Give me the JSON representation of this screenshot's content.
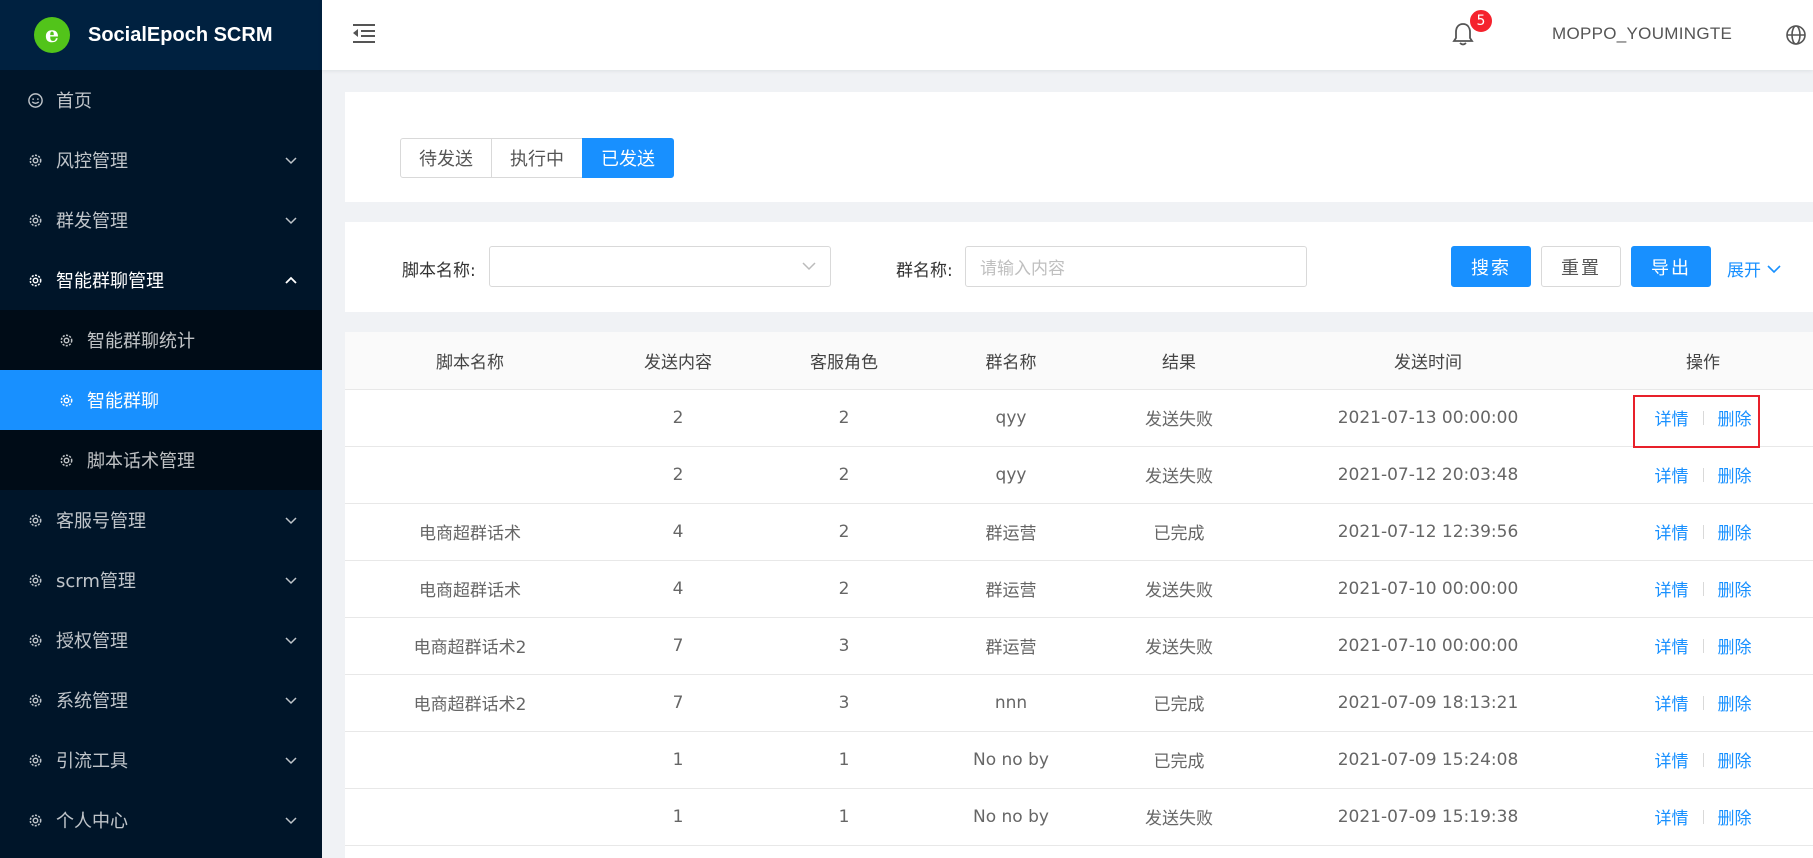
{
  "app": {
    "title": "SocialEpoch SCRM",
    "logo_letter": "e"
  },
  "sidebar": {
    "items": [
      {
        "label": "首页",
        "icon": "smile-icon"
      },
      {
        "label": "风控管理",
        "icon": "gear-icon"
      },
      {
        "label": "群发管理",
        "icon": "gear-icon"
      },
      {
        "label": "智能群聊管理",
        "icon": "gear-icon",
        "open": true,
        "children": [
          {
            "label": "智能群聊统计"
          },
          {
            "label": "智能群聊",
            "active": true
          },
          {
            "label": "脚本话术管理"
          }
        ]
      },
      {
        "label": "客服号管理",
        "icon": "gear-icon"
      },
      {
        "label": "scrm管理",
        "icon": "gear-icon"
      },
      {
        "label": "授权管理",
        "icon": "gear-icon"
      },
      {
        "label": "系统管理",
        "icon": "gear-icon"
      },
      {
        "label": "引流工具",
        "icon": "gear-icon"
      },
      {
        "label": "个人中心",
        "icon": "gear-icon"
      }
    ]
  },
  "header": {
    "notification_count": "5",
    "username": "MOPPO_YOUMINGTE"
  },
  "tabs": [
    {
      "label": "待发送",
      "active": false
    },
    {
      "label": "执行中",
      "active": false
    },
    {
      "label": "已发送",
      "active": true
    }
  ],
  "filter": {
    "script_label": "脚本名称:",
    "group_label": "群名称:",
    "group_placeholder": "请输入内容",
    "search": "搜索",
    "reset": "重置",
    "export": "导出",
    "expand": "展开"
  },
  "table": {
    "columns": [
      "脚本名称",
      "发送内容",
      "客服角色",
      "群名称",
      "结果",
      "发送时间",
      "操作"
    ],
    "action_detail": "详情",
    "action_delete": "删除",
    "rows": [
      [
        "",
        "2",
        "2",
        "qyy",
        "发送失败",
        "2021-07-13 00:00:00"
      ],
      [
        "",
        "2",
        "2",
        "qyy",
        "发送失败",
        "2021-07-12 20:03:48"
      ],
      [
        "电商超群话术",
        "4",
        "2",
        "群运营",
        "已完成",
        "2021-07-12 12:39:56"
      ],
      [
        "电商超群话术",
        "4",
        "2",
        "群运营",
        "发送失败",
        "2021-07-10 00:00:00"
      ],
      [
        "电商超群话术2",
        "7",
        "3",
        "群运营",
        "发送失败",
        "2021-07-10 00:00:00"
      ],
      [
        "电商超群话术2",
        "7",
        "3",
        "nnn",
        "已完成",
        "2021-07-09 18:13:21"
      ],
      [
        "",
        "1",
        "1",
        "No no by",
        "已完成",
        "2021-07-09 15:24:08"
      ],
      [
        "",
        "1",
        "1",
        "No no by",
        "发送失败",
        "2021-07-09 15:19:38"
      ]
    ]
  },
  "colors": {
    "primary": "#1890ff",
    "sidebar_bg": "#001529",
    "highlight": "#e8202a"
  }
}
